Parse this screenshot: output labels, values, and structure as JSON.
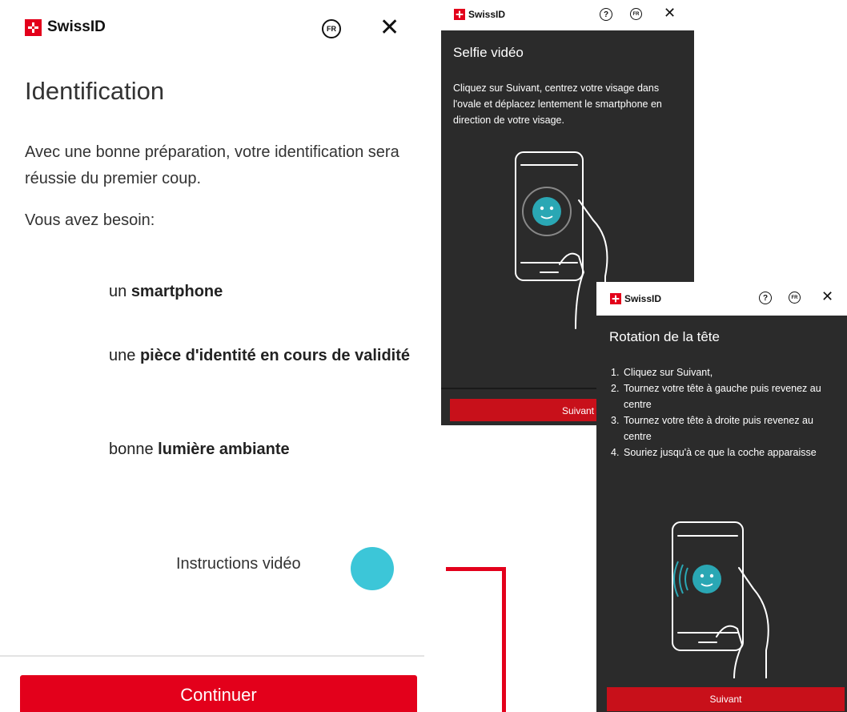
{
  "main": {
    "brand": "SwissID",
    "lang_badge": "FR",
    "close_icon": "✕",
    "title": "Identification",
    "intro": "Avec une bonne préparation, votre identification sera réussie du premier coup.",
    "need_label": "Vous avez besoin:",
    "requirements": [
      {
        "prefix": "un ",
        "strong": "smartphone",
        "suffix": ""
      },
      {
        "prefix": "une ",
        "strong": "pièce d'identité en cours de validité",
        "suffix": ""
      },
      {
        "prefix": "bonne ",
        "strong": "lumière ambiante",
        "suffix": ""
      }
    ],
    "video_label": "Instructions vidéo",
    "continue_label": "Continuer"
  },
  "selfie_panel": {
    "brand": "SwissID",
    "help_icon": "?",
    "lang_badge": "FR",
    "close_icon": "✕",
    "title": "Selfie vidéo",
    "description": "Cliquez sur Suivant, centrez votre visage dans l'ovale et déplacez lentement le smartphone en direction de votre visage.",
    "button_label": "Suivant"
  },
  "rotation_panel": {
    "brand": "SwissID",
    "help_icon": "?",
    "lang_badge": "FR",
    "close_icon": "✕",
    "title": "Rotation de la tête",
    "steps": [
      {
        "num": "1.",
        "text": "Cliquez sur Suivant,"
      },
      {
        "num": "2.",
        "text": "Tournez votre tête à gauche puis revenez au centre"
      },
      {
        "num": "3.",
        "text": "Tournez votre tête à droite puis revenez au centre"
      },
      {
        "num": "4.",
        "text": "Souriez jusqu'à ce que la coche apparaisse"
      }
    ],
    "button_label": "Suivant"
  },
  "colors": {
    "brand_red": "#e3001b",
    "accent_cyan": "#3cc6d8",
    "dark_panel": "#2b2b2b",
    "face_teal": "#2aa7b4"
  }
}
